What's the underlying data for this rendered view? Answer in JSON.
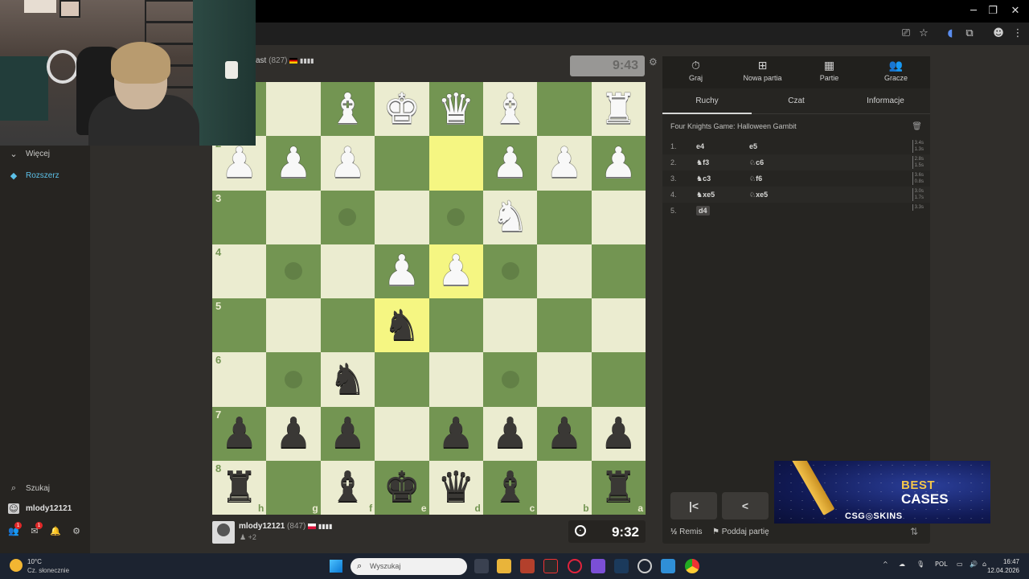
{
  "colors": {
    "light_square": "#ebecd0",
    "dark_square": "#739552",
    "highlight_light": "#f5f682",
    "highlight_dark": "#b9ca43",
    "panel_bg": "#262522"
  },
  "sidebar": {
    "more_label": "Więcej",
    "premium_label": "Rozszerz",
    "search_label": "Szukaj",
    "username": "mlody12121",
    "friends_badge": "1",
    "messages_badge": "1"
  },
  "top_player": {
    "name_partial": "ast",
    "rating": "(827)",
    "flag": "de",
    "clock": "9:43"
  },
  "bottom_player": {
    "name": "mlody12121",
    "rating": "(847)",
    "flag": "pl",
    "captured": "+2",
    "clock": "9:32"
  },
  "board": {
    "orientation": "black",
    "ranks": [
      "1",
      "2",
      "3",
      "4",
      "5",
      "6",
      "7",
      "8"
    ],
    "files": [
      "h",
      "g",
      "f",
      "e",
      "d",
      "c",
      "b",
      "a"
    ],
    "rows": [
      [
        "",
        "",
        "wB",
        "wK",
        "wQ",
        "wB",
        "",
        "wR"
      ],
      [
        "wP",
        "wP",
        "wP",
        "",
        "",
        "wP",
        "wP",
        "wP"
      ],
      [
        "",
        "",
        "",
        "",
        "",
        "wN",
        "",
        ""
      ],
      [
        "",
        "",
        "",
        "wP",
        "wP",
        "",
        "",
        ""
      ],
      [
        "",
        "",
        "",
        "bN",
        "",
        "",
        "",
        ""
      ],
      [
        "",
        "",
        "bN",
        "",
        "",
        "",
        "",
        ""
      ],
      [
        "bP",
        "bP",
        "bP",
        "",
        "bP",
        "bP",
        "bP",
        "bP"
      ],
      [
        "bR",
        "",
        "bB",
        "bK",
        "bQ",
        "bB",
        "",
        "bR"
      ]
    ],
    "highlights": [
      [
        1,
        4
      ],
      [
        3,
        4
      ],
      [
        4,
        3
      ]
    ],
    "move_dots": [
      [
        2,
        2
      ],
      [
        2,
        4
      ],
      [
        3,
        1
      ],
      [
        3,
        5
      ],
      [
        5,
        1
      ],
      [
        5,
        5
      ]
    ]
  },
  "panel": {
    "tabs": [
      {
        "label": "Graj",
        "icon": "stopwatch-icon",
        "glyph": "⏱"
      },
      {
        "label": "Nowa partia",
        "icon": "plus-square-icon",
        "glyph": "⊞"
      },
      {
        "label": "Partie",
        "icon": "board-icon",
        "glyph": "▦"
      },
      {
        "label": "Gracze",
        "icon": "players-icon",
        "glyph": "👥"
      }
    ],
    "subtabs": [
      "Ruchy",
      "Czat",
      "Informacje"
    ],
    "opening": "Four Knights Game: Halloween Gambit",
    "moves": [
      {
        "num": "1.",
        "white": "e4",
        "white_piece": "",
        "black": "e5",
        "black_piece": "",
        "times": [
          "3.4s",
          "1.3s"
        ]
      },
      {
        "num": "2.",
        "white": "f3",
        "white_piece": "♞",
        "black": "c6",
        "black_piece": "♘",
        "times": [
          "2.8s",
          "1.5s"
        ]
      },
      {
        "num": "3.",
        "white": "c3",
        "white_piece": "♞",
        "black": "f6",
        "black_piece": "♘",
        "times": [
          "3.6s",
          "0.8s"
        ]
      },
      {
        "num": "4.",
        "white": "xe5",
        "white_piece": "♞",
        "black": "xe5",
        "black_piece": "♘",
        "times": [
          "3.0s",
          "1.7s"
        ]
      },
      {
        "num": "5.",
        "white": "d4",
        "white_piece": "",
        "black": "",
        "black_piece": "",
        "times": [
          "3.3s",
          ""
        ]
      }
    ],
    "nav_first": "|<",
    "nav_prev": "<",
    "draw_label": "Remis",
    "draw_prefix": "½",
    "resign_label": "Poddaj partię"
  },
  "ad": {
    "line1": "BEST",
    "line2": "CASES",
    "brand": "CSG◎SKINS"
  },
  "taskbar": {
    "temp": "10°C",
    "weather": "Cz. słonecznie",
    "search_placeholder": "Wyszukaj",
    "lang": "POL",
    "time": "16:47",
    "date": "12.04.2026"
  }
}
